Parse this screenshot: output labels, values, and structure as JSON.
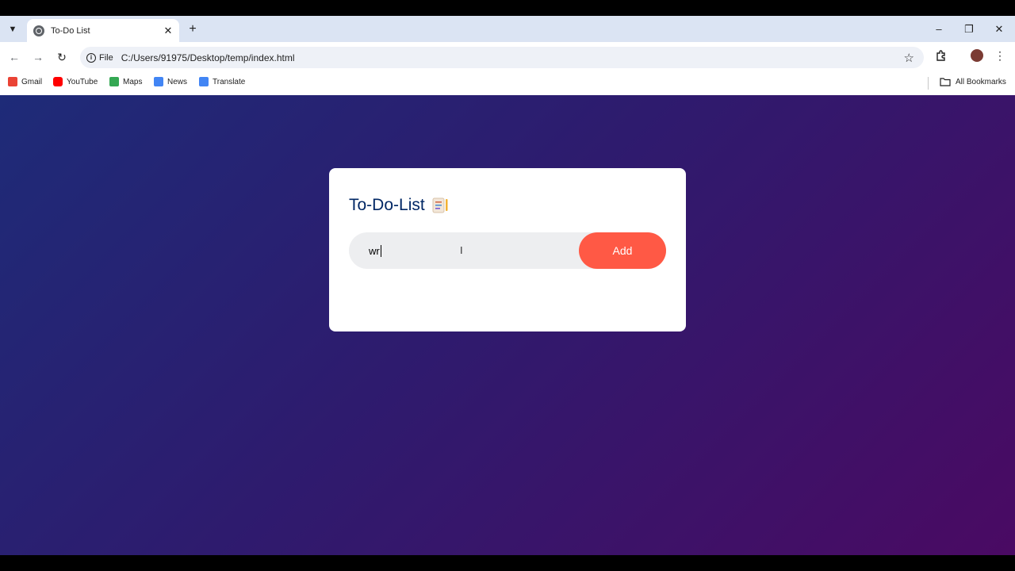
{
  "browser": {
    "tab_title": "To-Do List",
    "scheme_chip": "File",
    "url": "C:/Users/91975/Desktop/temp/index.html",
    "bookmarks": [
      {
        "label": "Gmail",
        "icon": "gmail-icon",
        "color": "#ea4335"
      },
      {
        "label": "YouTube",
        "icon": "youtube-icon",
        "color": "#ff0000"
      },
      {
        "label": "Maps",
        "icon": "maps-icon",
        "color": "#34a853"
      },
      {
        "label": "News",
        "icon": "news-icon",
        "color": "#4285f4"
      },
      {
        "label": "Translate",
        "icon": "translate-icon",
        "color": "#4285f4"
      }
    ],
    "all_bookmarks": "All Bookmarks"
  },
  "app": {
    "title": "To-Do-List",
    "title_icon": "notepad-icon",
    "input_value": "wr",
    "add_label": "Add"
  },
  "colors": {
    "accent": "#ff5945",
    "title": "#002765",
    "input_bg": "#edeef0",
    "gradient_start": "#1e2b78",
    "gradient_end": "#4a0a63"
  }
}
